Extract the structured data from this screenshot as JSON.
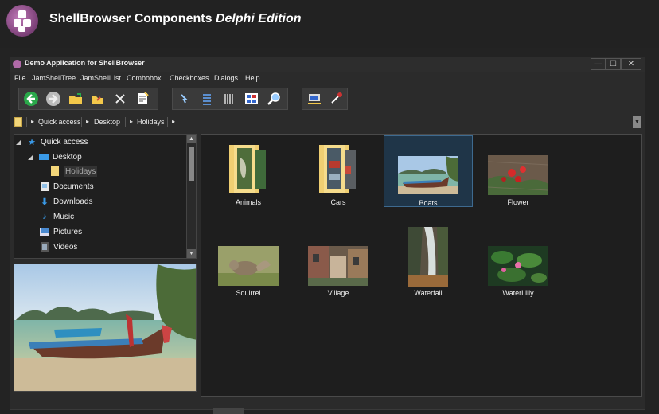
{
  "banner": {
    "title_main": "ShellBrowser Components",
    "title_italic": "Delphi Edition"
  },
  "window": {
    "title": "Demo Application for ShellBrowser",
    "controls": {
      "minimize": "—",
      "maximize": "☐",
      "close": "✕"
    }
  },
  "menu": [
    "File",
    "JamShellTree",
    "JamShellList",
    "Combobox",
    "Checkboxes",
    "Dialogs",
    "Help"
  ],
  "toolbar": {
    "buttons": [
      "back-icon",
      "forward-icon",
      "open-folder-icon",
      "up-folder-icon",
      "delete-icon",
      "properties-icon",
      "view-small-icon",
      "view-list-icon",
      "view-details-icon",
      "view-thumbnails-icon",
      "search-icon",
      "network-icon",
      "settings-icon"
    ]
  },
  "address": {
    "crumbs": [
      "Quick access",
      "Desktop",
      "Holidays"
    ]
  },
  "tree": {
    "items": [
      {
        "label": "Quick access",
        "icon": "star-icon"
      },
      {
        "label": "Desktop",
        "icon": "desktop-icon"
      },
      {
        "label": "Holidays",
        "icon": "folder-icon"
      },
      {
        "label": "Documents",
        "icon": "documents-icon"
      },
      {
        "label": "Downloads",
        "icon": "downloads-icon"
      },
      {
        "label": "Music",
        "icon": "music-icon"
      },
      {
        "label": "Pictures",
        "icon": "pictures-icon"
      },
      {
        "label": "Videos",
        "icon": "videos-icon"
      }
    ]
  },
  "files": {
    "items": [
      {
        "label": "Animals",
        "kind": "folder"
      },
      {
        "label": "Cars",
        "kind": "folder"
      },
      {
        "label": "Boats",
        "kind": "image",
        "selected": true
      },
      {
        "label": "Flower",
        "kind": "image"
      },
      {
        "label": "Squirrel",
        "kind": "image"
      },
      {
        "label": "Village",
        "kind": "image"
      },
      {
        "label": "Waterfall",
        "kind": "image"
      },
      {
        "label": "WaterLilly",
        "kind": "image"
      }
    ]
  },
  "colors": {
    "selection": "#1f3548",
    "folder": "#f3d67a",
    "accent": "#3e6a8f"
  }
}
